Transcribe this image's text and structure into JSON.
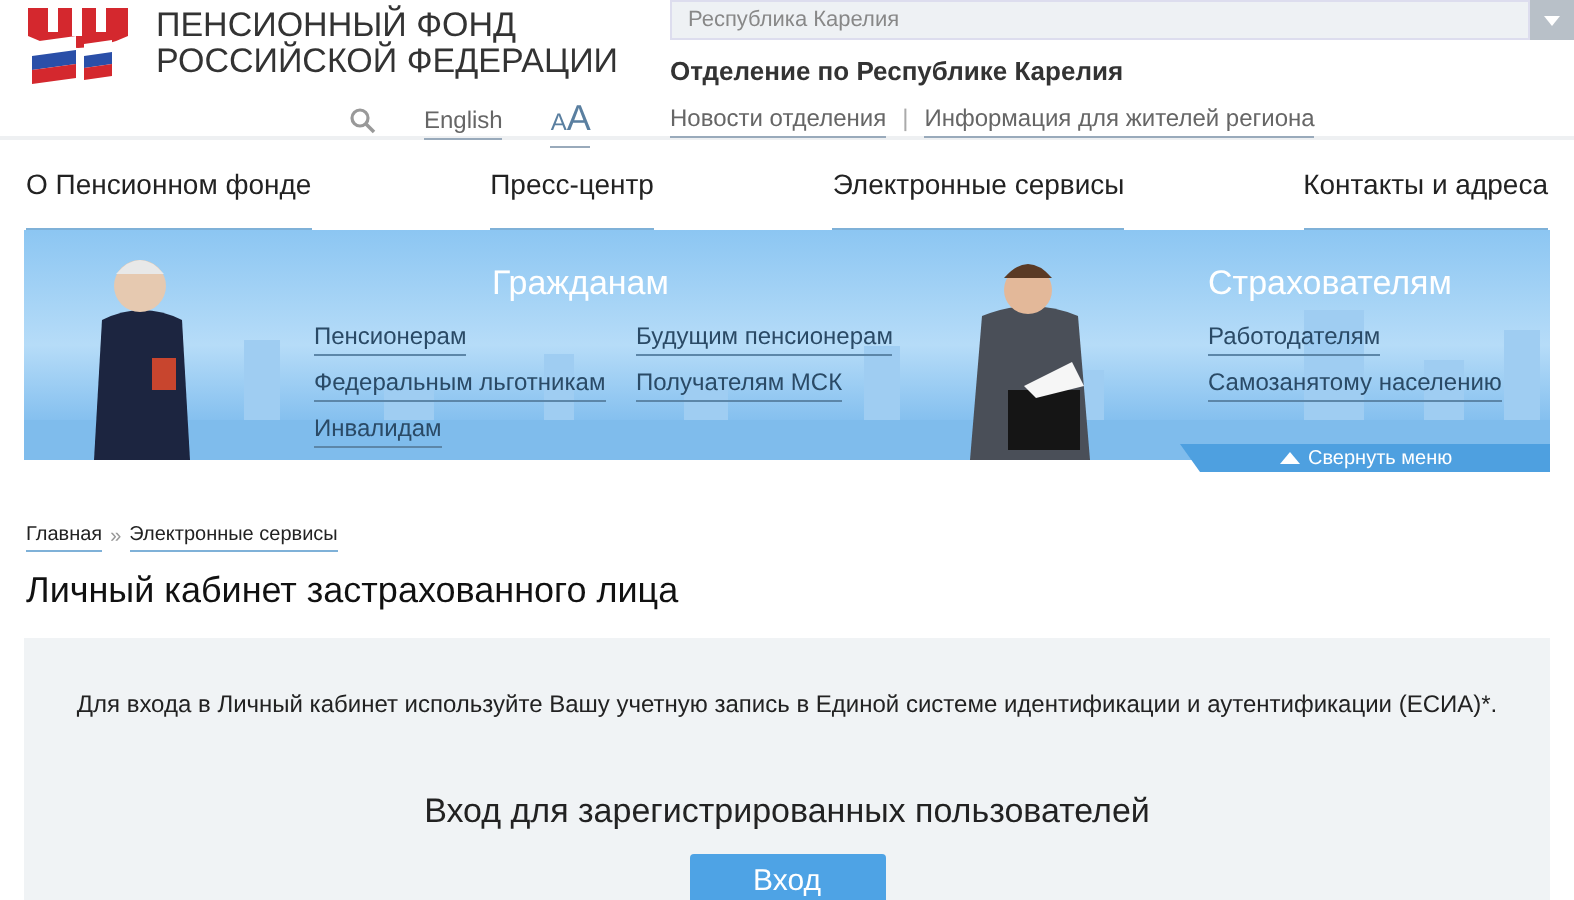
{
  "header": {
    "logo_lines": [
      "ПЕНСИОННЫЙ ФОНД",
      "РОССИЙСКОЙ ФЕДЕРАЦИИ"
    ],
    "language_link": "English",
    "font_toggle": [
      "A",
      "A"
    ],
    "region_select": {
      "value": "Республика Карелия"
    },
    "office_title": "Отделение по Республике Карелия",
    "office_links": [
      "Новости отделения",
      "Информация для жителей региона"
    ],
    "office_links_separator": "|"
  },
  "nav": [
    "О Пенсионном фонде",
    "Пресс-центр",
    "Электронные сервисы",
    "Контакты и адреса"
  ],
  "banner": {
    "groups": [
      {
        "title": "Гражданам",
        "columns": [
          [
            "Пенсионерам",
            "Федеральным льготникам",
            "Инвалидам"
          ],
          [
            "Будущим пенсионерам",
            "Получателям МСК"
          ]
        ]
      },
      {
        "title": "Страхователям",
        "columns": [
          [
            "Работодателям",
            "Самозанятому населению"
          ]
        ]
      }
    ],
    "collapse": "Свернуть меню"
  },
  "breadcrumb": {
    "items": [
      "Главная",
      "Электронные сервисы"
    ],
    "separator": "»"
  },
  "page_title": "Личный кабинет застрахованного лица",
  "panel": {
    "notice": "Для входа в Личный кабинет используйте Вашу учетную запись в Единой системе идентификации и аутентификации (ЕСИА)*.",
    "login_heading": "Вход для зарегистрированных пользователей",
    "login_button": "Вход"
  }
}
